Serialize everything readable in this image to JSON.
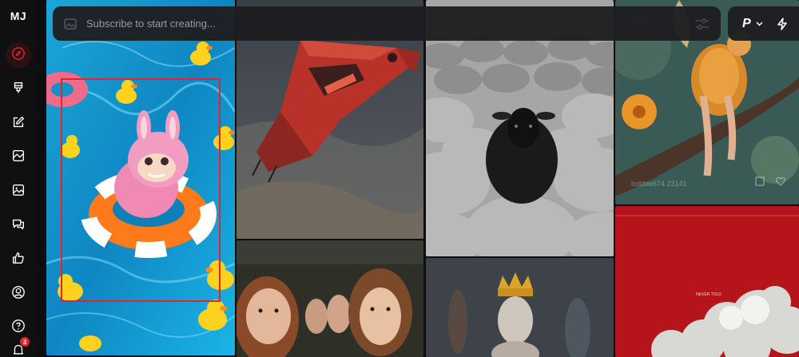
{
  "app": {
    "logo": "MJ"
  },
  "search": {
    "placeholder": "Subscribe to start creating..."
  },
  "user": {
    "initial": "P"
  },
  "sidebar": {
    "items": [
      {
        "name": "explore",
        "icon": "compass-icon",
        "active": true
      },
      {
        "name": "create",
        "icon": "brush-icon"
      },
      {
        "name": "edit",
        "icon": "pencil-square-icon"
      },
      {
        "name": "organize",
        "icon": "folder-images-icon"
      },
      {
        "name": "gallery",
        "icon": "image-icon"
      },
      {
        "name": "chat",
        "icon": "chat-bubbles-icon"
      },
      {
        "name": "rank",
        "icon": "thumbs-up-icon"
      },
      {
        "name": "profile",
        "icon": "user-circle-icon"
      },
      {
        "name": "help",
        "icon": "question-circle-icon"
      },
      {
        "name": "notifications",
        "icon": "bell-icon",
        "badge": "3"
      }
    ]
  },
  "gallery": {
    "tiles": [
      {
        "name": "tile-pink-creature-pool"
      },
      {
        "name": "tile-red-spaceship"
      },
      {
        "name": "tile-black-sheep"
      },
      {
        "name": "tile-fairy-branch",
        "overlay_text": "bobbie674 23141"
      },
      {
        "name": "tile-girls-car"
      },
      {
        "name": "tile-chess-queen"
      },
      {
        "name": "tile-red-clouds-poster",
        "caption": "NEVER TOLD"
      }
    ]
  },
  "colors": {
    "accent": "#e5232b",
    "background": "#0e0e10",
    "panel": "#1e1e21"
  }
}
